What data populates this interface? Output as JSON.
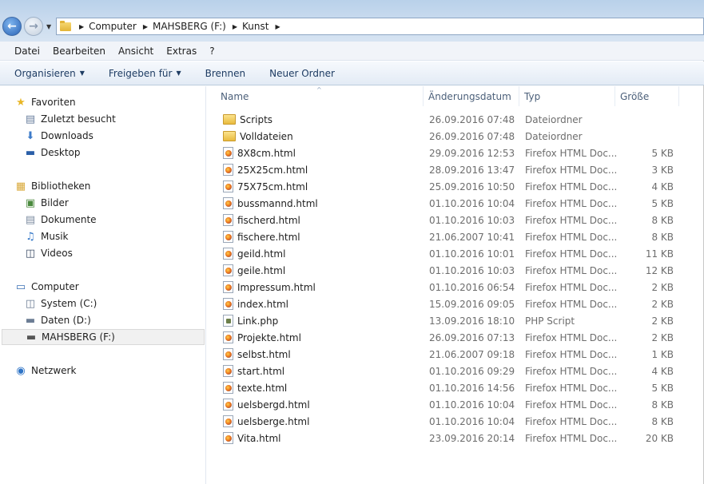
{
  "address": {
    "crumbs": [
      "Computer",
      "MAHSBERG (F:)",
      "Kunst"
    ]
  },
  "menu": [
    "Datei",
    "Bearbeiten",
    "Ansicht",
    "Extras",
    "?"
  ],
  "toolbar": {
    "organize": "Organisieren",
    "share": "Freigeben für",
    "burn": "Brennen",
    "new_folder": "Neuer Ordner"
  },
  "nav": {
    "favorites": {
      "label": "Favoriten",
      "items": [
        "Zuletzt besucht",
        "Downloads",
        "Desktop"
      ]
    },
    "libraries": {
      "label": "Bibliotheken",
      "items": [
        "Bilder",
        "Dokumente",
        "Musik",
        "Videos"
      ]
    },
    "computer": {
      "label": "Computer",
      "items": [
        "System (C:)",
        "Daten (D:)",
        "MAHSBERG (F:)"
      ]
    },
    "network": {
      "label": "Netzwerk"
    }
  },
  "columns": {
    "name": "Name",
    "date": "Änderungsdatum",
    "type": "Typ",
    "size": "Größe"
  },
  "files": [
    {
      "name": "Scripts",
      "date": "26.09.2016 07:48",
      "type": "Dateiordner",
      "size": "",
      "icon": "folder-icon"
    },
    {
      "name": "Volldateien",
      "date": "26.09.2016 07:48",
      "type": "Dateiordner",
      "size": "",
      "icon": "folder-icon"
    },
    {
      "name": "8X8cm.html",
      "date": "29.09.2016 12:53",
      "type": "Firefox HTML Doc...",
      "size": "5 KB",
      "icon": "firefox-html-icon"
    },
    {
      "name": "25X25cm.html",
      "date": "28.09.2016 13:47",
      "type": "Firefox HTML Doc...",
      "size": "3 KB",
      "icon": "firefox-html-icon"
    },
    {
      "name": "75X75cm.html",
      "date": "25.09.2016 10:50",
      "type": "Firefox HTML Doc...",
      "size": "4 KB",
      "icon": "firefox-html-icon"
    },
    {
      "name": "bussmannd.html",
      "date": "01.10.2016 10:04",
      "type": "Firefox HTML Doc...",
      "size": "5 KB",
      "icon": "firefox-html-icon"
    },
    {
      "name": "fischerd.html",
      "date": "01.10.2016 10:03",
      "type": "Firefox HTML Doc...",
      "size": "8 KB",
      "icon": "firefox-html-icon"
    },
    {
      "name": "fischere.html",
      "date": "21.06.2007 10:41",
      "type": "Firefox HTML Doc...",
      "size": "8 KB",
      "icon": "firefox-html-icon"
    },
    {
      "name": "geild.html",
      "date": "01.10.2016 10:01",
      "type": "Firefox HTML Doc...",
      "size": "11 KB",
      "icon": "firefox-html-icon"
    },
    {
      "name": "geile.html",
      "date": "01.10.2016 10:03",
      "type": "Firefox HTML Doc...",
      "size": "12 KB",
      "icon": "firefox-html-icon"
    },
    {
      "name": "Impressum.html",
      "date": "01.10.2016 06:54",
      "type": "Firefox HTML Doc...",
      "size": "2 KB",
      "icon": "firefox-html-icon"
    },
    {
      "name": "index.html",
      "date": "15.09.2016 09:05",
      "type": "Firefox HTML Doc...",
      "size": "2 KB",
      "icon": "firefox-html-icon"
    },
    {
      "name": "Link.php",
      "date": "13.09.2016 18:10",
      "type": "PHP Script",
      "size": "2 KB",
      "icon": "php-script-icon"
    },
    {
      "name": "Projekte.html",
      "date": "26.09.2016 07:13",
      "type": "Firefox HTML Doc...",
      "size": "2 KB",
      "icon": "firefox-html-icon"
    },
    {
      "name": "selbst.html",
      "date": "21.06.2007 09:18",
      "type": "Firefox HTML Doc...",
      "size": "1 KB",
      "icon": "firefox-html-icon"
    },
    {
      "name": "start.html",
      "date": "01.10.2016 09:29",
      "type": "Firefox HTML Doc...",
      "size": "4 KB",
      "icon": "firefox-html-icon"
    },
    {
      "name": "texte.html",
      "date": "01.10.2016 14:56",
      "type": "Firefox HTML Doc...",
      "size": "5 KB",
      "icon": "firefox-html-icon"
    },
    {
      "name": "uelsbergd.html",
      "date": "01.10.2016 10:04",
      "type": "Firefox HTML Doc...",
      "size": "8 KB",
      "icon": "firefox-html-icon"
    },
    {
      "name": "uelsberge.html",
      "date": "01.10.2016 10:04",
      "type": "Firefox HTML Doc...",
      "size": "8 KB",
      "icon": "firefox-html-icon"
    },
    {
      "name": "Vita.html",
      "date": "23.09.2016 20:14",
      "type": "Firefox HTML Doc...",
      "size": "20 KB",
      "icon": "firefox-html-icon"
    }
  ]
}
